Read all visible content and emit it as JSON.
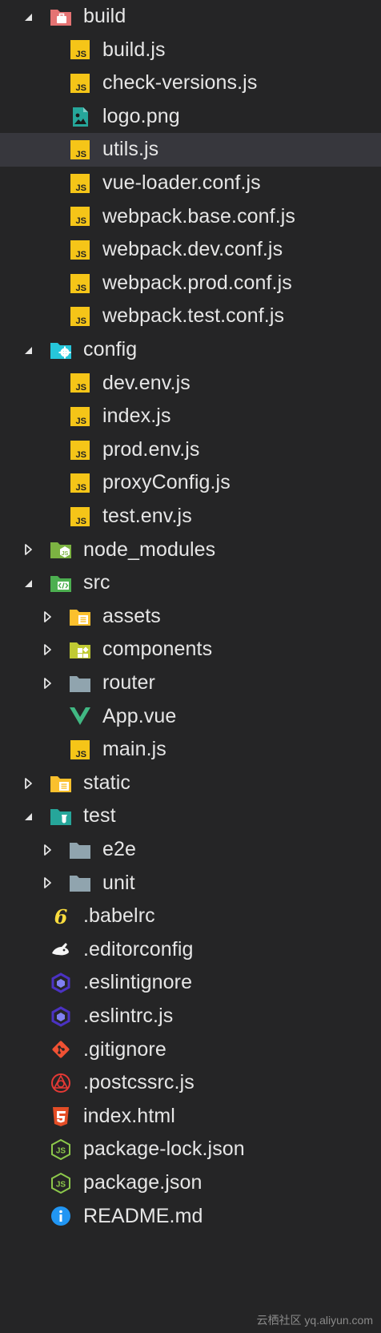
{
  "explorer": {
    "items": [
      {
        "id": "build",
        "label": "build",
        "level": 0,
        "twisty": "open",
        "icon": "folder-build-icon"
      },
      {
        "id": "build-js",
        "label": "build.js",
        "level": 1,
        "twisty": "none",
        "icon": "js-icon"
      },
      {
        "id": "check-versions-js",
        "label": "check-versions.js",
        "level": 1,
        "twisty": "none",
        "icon": "js-icon"
      },
      {
        "id": "logo-png",
        "label": "logo.png",
        "level": 1,
        "twisty": "none",
        "icon": "image-icon"
      },
      {
        "id": "utils-js",
        "label": "utils.js",
        "level": 1,
        "twisty": "none",
        "icon": "js-icon",
        "selected": true
      },
      {
        "id": "vue-loader-conf-js",
        "label": "vue-loader.conf.js",
        "level": 1,
        "twisty": "none",
        "icon": "js-icon"
      },
      {
        "id": "webpack-base-conf-js",
        "label": "webpack.base.conf.js",
        "level": 1,
        "twisty": "none",
        "icon": "js-icon"
      },
      {
        "id": "webpack-dev-conf-js",
        "label": "webpack.dev.conf.js",
        "level": 1,
        "twisty": "none",
        "icon": "js-icon"
      },
      {
        "id": "webpack-prod-conf-js",
        "label": "webpack.prod.conf.js",
        "level": 1,
        "twisty": "none",
        "icon": "js-icon"
      },
      {
        "id": "webpack-test-conf-js",
        "label": "webpack.test.conf.js",
        "level": 1,
        "twisty": "none",
        "icon": "js-icon"
      },
      {
        "id": "config",
        "label": "config",
        "level": 0,
        "twisty": "open",
        "icon": "folder-config-icon"
      },
      {
        "id": "dev-env-js",
        "label": "dev.env.js",
        "level": 1,
        "twisty": "none",
        "icon": "js-icon"
      },
      {
        "id": "index-js",
        "label": "index.js",
        "level": 1,
        "twisty": "none",
        "icon": "js-icon"
      },
      {
        "id": "prod-env-js",
        "label": "prod.env.js",
        "level": 1,
        "twisty": "none",
        "icon": "js-icon"
      },
      {
        "id": "proxyconfig-js",
        "label": "proxyConfig.js",
        "level": 1,
        "twisty": "none",
        "icon": "js-icon"
      },
      {
        "id": "test-env-js",
        "label": "test.env.js",
        "level": 1,
        "twisty": "none",
        "icon": "js-icon"
      },
      {
        "id": "node-modules",
        "label": "node_modules",
        "level": 0,
        "twisty": "closed",
        "icon": "folder-node-icon"
      },
      {
        "id": "src",
        "label": "src",
        "level": 0,
        "twisty": "open",
        "icon": "folder-src-icon"
      },
      {
        "id": "assets",
        "label": "assets",
        "level": 1,
        "twisty": "closed",
        "icon": "folder-assets-icon"
      },
      {
        "id": "components",
        "label": "components",
        "level": 1,
        "twisty": "closed",
        "icon": "folder-components-icon"
      },
      {
        "id": "router",
        "label": "router",
        "level": 1,
        "twisty": "closed",
        "icon": "folder-icon"
      },
      {
        "id": "app-vue",
        "label": "App.vue",
        "level": 1,
        "twisty": "none",
        "icon": "vue-icon"
      },
      {
        "id": "main-js",
        "label": "main.js",
        "level": 1,
        "twisty": "none",
        "icon": "js-icon"
      },
      {
        "id": "static",
        "label": "static",
        "level": 0,
        "twisty": "closed",
        "icon": "folder-static-icon"
      },
      {
        "id": "test",
        "label": "test",
        "level": 0,
        "twisty": "open",
        "icon": "folder-test-icon"
      },
      {
        "id": "e2e",
        "label": "e2e",
        "level": 1,
        "twisty": "closed",
        "icon": "folder-icon"
      },
      {
        "id": "unit",
        "label": "unit",
        "level": 1,
        "twisty": "closed",
        "icon": "folder-icon"
      },
      {
        "id": "babelrc",
        "label": ".babelrc",
        "level": 0,
        "twisty": "none",
        "icon": "babel-icon"
      },
      {
        "id": "editorconfig",
        "label": ".editorconfig",
        "level": 0,
        "twisty": "none",
        "icon": "editorconfig-icon"
      },
      {
        "id": "eslintignore",
        "label": ".eslintignore",
        "level": 0,
        "twisty": "none",
        "icon": "eslint-icon"
      },
      {
        "id": "eslintrc-js",
        "label": ".eslintrc.js",
        "level": 0,
        "twisty": "none",
        "icon": "eslint-icon"
      },
      {
        "id": "gitignore",
        "label": ".gitignore",
        "level": 0,
        "twisty": "none",
        "icon": "git-icon"
      },
      {
        "id": "postcssrc-js",
        "label": ".postcssrc.js",
        "level": 0,
        "twisty": "none",
        "icon": "postcss-icon"
      },
      {
        "id": "index-html",
        "label": "index.html",
        "level": 0,
        "twisty": "none",
        "icon": "html5-icon"
      },
      {
        "id": "package-lock-json",
        "label": "package-lock.json",
        "level": 0,
        "twisty": "none",
        "icon": "nodejs-icon"
      },
      {
        "id": "package-json",
        "label": "package.json",
        "level": 0,
        "twisty": "none",
        "icon": "nodejs-icon"
      },
      {
        "id": "readme-md",
        "label": "README.md",
        "level": 0,
        "twisty": "none",
        "icon": "info-icon"
      }
    ]
  },
  "watermark": "云栖社区 yq.aliyun.com",
  "colors": {
    "background": "#252526",
    "selected": "#37373d",
    "text": "#e6e6e6",
    "js_yellow": "#f5c518",
    "vue_green": "#41b883",
    "node_green": "#8cc84b",
    "html_orange": "#e44d26",
    "git_orange": "#f05133",
    "eslint_purple": "#4b32c3",
    "info_blue": "#2196f3"
  }
}
